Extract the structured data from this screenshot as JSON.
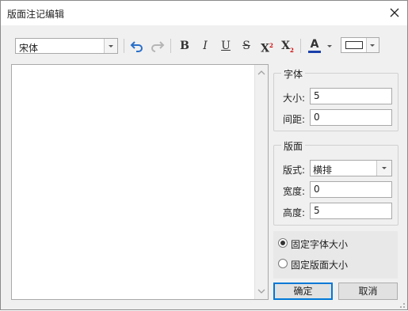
{
  "window": {
    "title": "版面注记编辑"
  },
  "toolbar": {
    "font_family": "宋体",
    "bold": "B",
    "italic": "I",
    "underline": "U",
    "strike": "S",
    "superscript": "X",
    "subscript": "X",
    "font_color_label": "A",
    "font_color": "#1a3faa",
    "icons": [
      "undo-icon",
      "redo-icon",
      "font-color-icon",
      "border-style-icon"
    ]
  },
  "font_group": {
    "title": "字体",
    "size_label": "大小:",
    "size_value": "5",
    "spacing_label": "间距:",
    "spacing_value": "0"
  },
  "layout_group": {
    "title": "版面",
    "style_label": "版式:",
    "style_value": "横排",
    "width_label": "宽度:",
    "width_value": "0",
    "height_label": "高度:",
    "height_value": "5"
  },
  "mode": {
    "fixed_font_label": "固定字体大小",
    "fixed_layout_label": "固定版面大小",
    "selected": "fixed_font"
  },
  "buttons": {
    "ok": "确定",
    "cancel": "取消"
  }
}
